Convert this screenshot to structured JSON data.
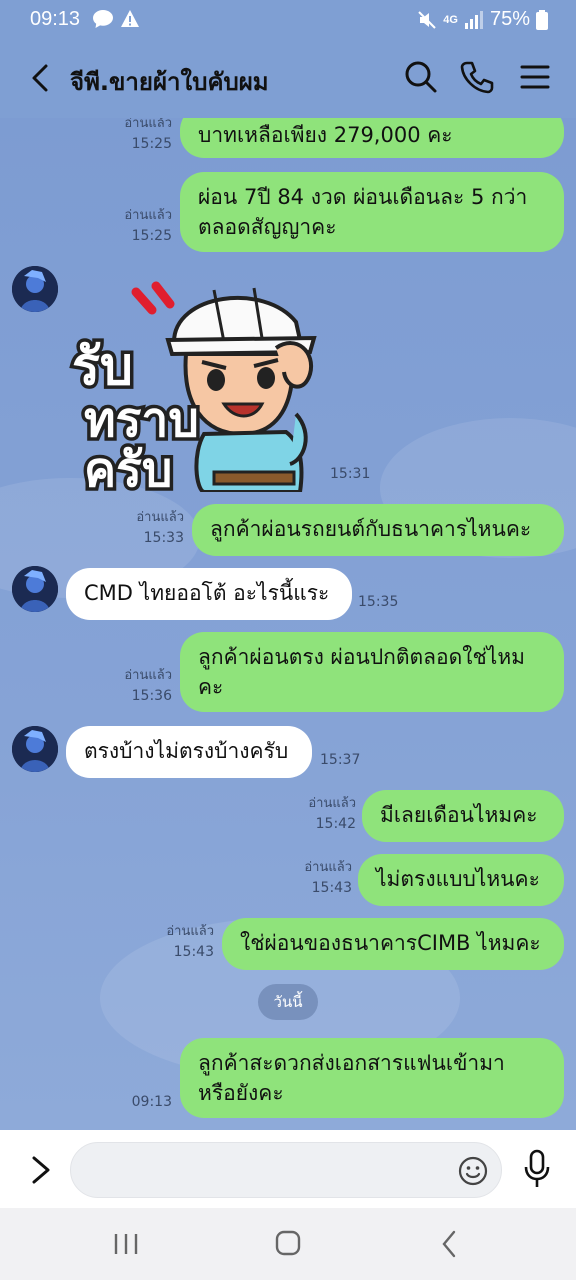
{
  "status_bar": {
    "time": "09:13",
    "battery": "75%",
    "network": "4G",
    "icons": [
      "chat-bubble-icon",
      "warning-icon",
      "mute-icon",
      "signal-icon",
      "battery-icon"
    ]
  },
  "header": {
    "title": "จีพี.ขายผ้าใบคับผม",
    "icons": [
      "back-icon",
      "search-icon",
      "phone-icon",
      "menu-icon"
    ]
  },
  "messages": [
    {
      "side": "me",
      "read": "อ่านแล้ว",
      "time": "15:25",
      "lines": [
        "บาทเหลือเพียง 279,000 คะ"
      ]
    },
    {
      "side": "me",
      "read": "อ่านแล้ว",
      "time": "15:25",
      "lines": [
        "ผ่อน 7ปี 84 งวด ผ่อนเดือนละ 5 กว่า",
        "ตลอดสัญญาคะ"
      ]
    },
    {
      "side": "other",
      "type": "sticker",
      "time": "15:31",
      "sticker_text": [
        "รับ",
        "ทราบ",
        "ครับ"
      ]
    },
    {
      "side": "me",
      "read": "อ่านแล้ว",
      "time": "15:33",
      "lines": [
        "ลูกค้าผ่อนรถยนต์กับธนาคารไหนคะ"
      ]
    },
    {
      "side": "other",
      "time": "15:35",
      "lines": [
        "CMD ไทยออโต้ อะไรนี้แระ"
      ]
    },
    {
      "side": "me",
      "read": "อ่านแล้ว",
      "time": "15:36",
      "lines": [
        "ลูกค้าผ่อนตรง ผ่อนปกติตลอดใช่ไหม",
        "คะ"
      ]
    },
    {
      "side": "other",
      "time": "15:37",
      "lines": [
        "ตรงบ้างไม่ตรงบ้างครับ"
      ]
    },
    {
      "side": "me",
      "read": "อ่านแล้ว",
      "time": "15:42",
      "lines": [
        "มีเลยเดือนไหมคะ"
      ]
    },
    {
      "side": "me",
      "read": "อ่านแล้ว",
      "time": "15:43",
      "lines": [
        "ไม่ตรงแบบไหนคะ"
      ]
    },
    {
      "side": "me",
      "read": "อ่านแล้ว",
      "time": "15:43",
      "lines": [
        "ใช่ผ่อนของธนาคารCIMB ไหมคะ"
      ]
    },
    {
      "side": "me",
      "read": "",
      "time": "09:13",
      "lines": [
        "ลูกค้าสะดวกส่งเอกสารแฟนเข้ามา",
        "หรือยังคะ"
      ]
    }
  ],
  "day_separator": "วันนี้",
  "input": {
    "placeholder": ""
  },
  "colors": {
    "background": "#7f9fd3",
    "my_bubble": "#8fe37b",
    "their_bubble": "#ffffff"
  }
}
